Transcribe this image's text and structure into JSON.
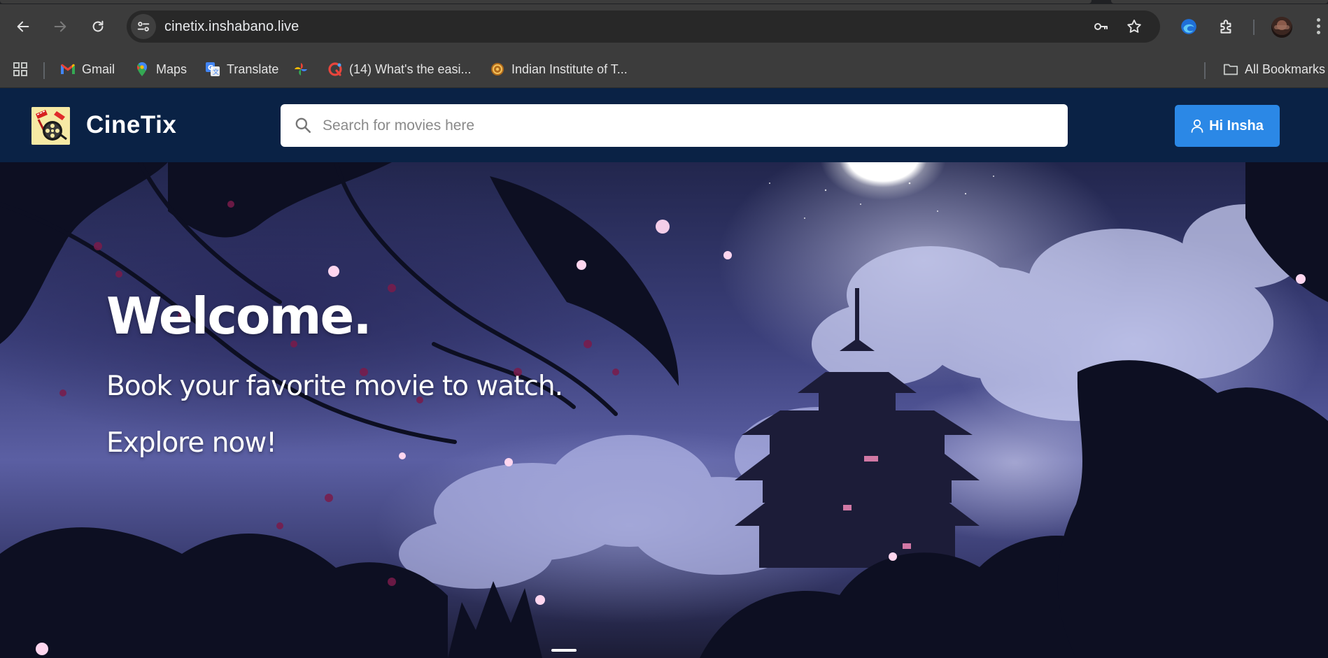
{
  "browser": {
    "url": "cinetix.inshabano.live",
    "bookmarks": [
      {
        "label": "Gmail",
        "icon": "gmail-icon"
      },
      {
        "label": "Maps",
        "icon": "maps-icon"
      },
      {
        "label": "Translate",
        "icon": "translate-icon"
      },
      {
        "label": "",
        "icon": "photos-icon"
      },
      {
        "label": "(14) What's the easi...",
        "icon": "site-favicon"
      },
      {
        "label": "Indian Institute of T...",
        "icon": "institute-favicon"
      }
    ],
    "all_bookmarks": "All Bookmarks"
  },
  "site": {
    "brand": "CineTix",
    "search_placeholder": "Search for movies here",
    "user_button": "Hi Insha"
  },
  "hero": {
    "title": "Welcome.",
    "subtitle": "Book your favorite movie to watch.",
    "cta": "Explore now!"
  },
  "colors": {
    "header_bg": "#0a2245",
    "accent": "#2b88e6",
    "chrome_bg": "#3c3c3c"
  }
}
